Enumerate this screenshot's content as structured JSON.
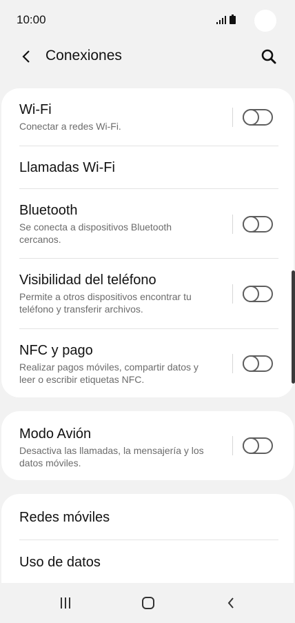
{
  "status_bar": {
    "time": "10:00",
    "icons": [
      "signal-icon",
      "battery-icon"
    ]
  },
  "header": {
    "back_icon": "chevron-left-icon",
    "title": "Conexiones",
    "search_icon": "search-icon"
  },
  "groups": [
    {
      "items": [
        {
          "title": "Wi-Fi",
          "subtitle": "Conectar a redes Wi-Fi.",
          "toggle": "off"
        },
        {
          "title": "Llamadas Wi-Fi"
        },
        {
          "title": "Bluetooth",
          "subtitle": "Se conecta a dispositivos Bluetooth cercanos.",
          "toggle": "off"
        },
        {
          "title": "Visibilidad del teléfono",
          "subtitle": "Permite a otros dispositivos encontrar tu teléfono y transferir archivos.",
          "toggle": "off"
        },
        {
          "title": "NFC y pago",
          "subtitle": "Realizar pagos móviles, compartir datos y leer o escribir etiquetas NFC.",
          "toggle": "off"
        }
      ]
    },
    {
      "items": [
        {
          "title": "Modo Avión",
          "subtitle": "Desactiva las llamadas, la mensajería y los datos móviles.",
          "toggle": "off"
        }
      ]
    },
    {
      "items": [
        {
          "title": "Redes móviles"
        },
        {
          "title": "Uso de datos"
        }
      ]
    }
  ],
  "nav_bar": {
    "recents_icon": "recents-icon",
    "home_icon": "home-icon",
    "back_icon": "back-icon"
  },
  "colors": {
    "background": "#f2f2f2",
    "card": "#ffffff",
    "toggle_outline": "#5e5e5e",
    "subtitle": "#6b6b6b"
  }
}
